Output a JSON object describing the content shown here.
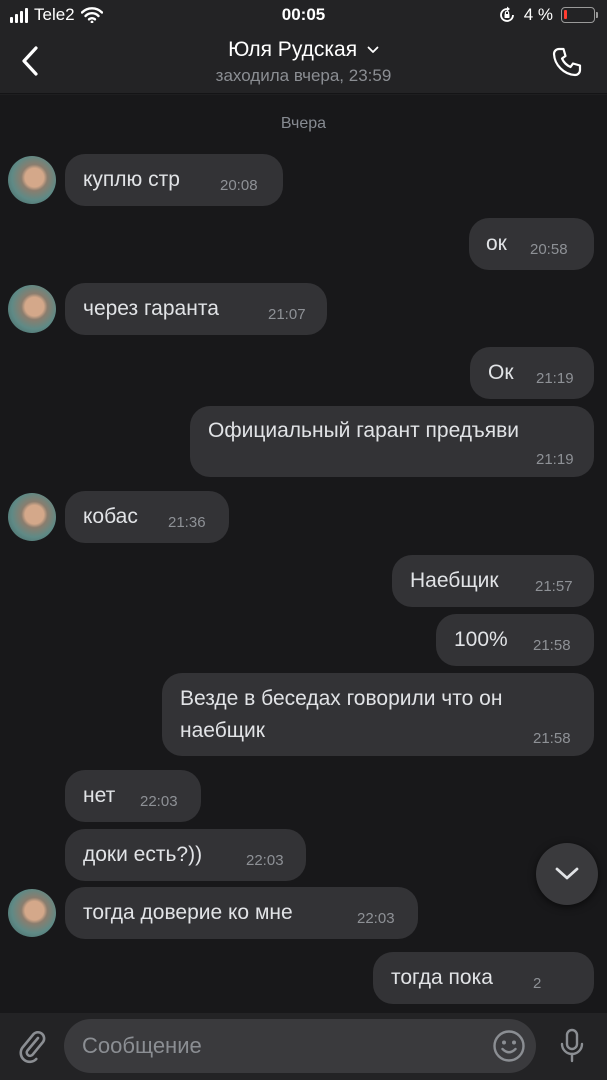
{
  "status": {
    "carrier": "Tele2",
    "time": "00:05",
    "battery": "4 %",
    "battery_level": 0.04
  },
  "header": {
    "title": "Юля Рудская",
    "subtitle": "заходила вчера, 23:59"
  },
  "chat": {
    "date_divider": "Вчера",
    "messages": [
      {
        "text": "куплю стр",
        "time": "20:08"
      },
      {
        "text": "ок",
        "time": "20:58"
      },
      {
        "text": "через гаранта",
        "time": "21:07"
      },
      {
        "text": "Ок",
        "time": "21:19"
      },
      {
        "text": "Официальный гарант предъяви",
        "time": "21:19"
      },
      {
        "text": "кобас",
        "time": "21:36"
      },
      {
        "text": "Наебщик",
        "time": "21:57"
      },
      {
        "text": "100%",
        "time": "21:58"
      },
      {
        "text": "Везде в беседах говорили что он наебщик",
        "time": "21:58"
      },
      {
        "text": "нет",
        "time": "22:03"
      },
      {
        "text": "доки есть?))",
        "time": "22:03"
      },
      {
        "text": "тогда доверие ко мне",
        "time": "22:03"
      },
      {
        "text": "тогда пока",
        "time": "2"
      }
    ]
  },
  "composer": {
    "placeholder": "Сообщение"
  },
  "icons": {
    "back": "chevron-left-icon",
    "call": "phone-icon",
    "title_chevron": "chevron-down-icon",
    "scroll": "chevron-down-icon",
    "attach": "paperclip-icon",
    "emoji": "smiley-icon",
    "mic": "microphone-icon",
    "wifi": "wifi-icon",
    "rotation_lock": "rotation-lock-icon"
  },
  "colors": {
    "background": "#18181a",
    "bubble": "#333336",
    "bar": "#232325",
    "battery_low": "#ff3b30"
  }
}
